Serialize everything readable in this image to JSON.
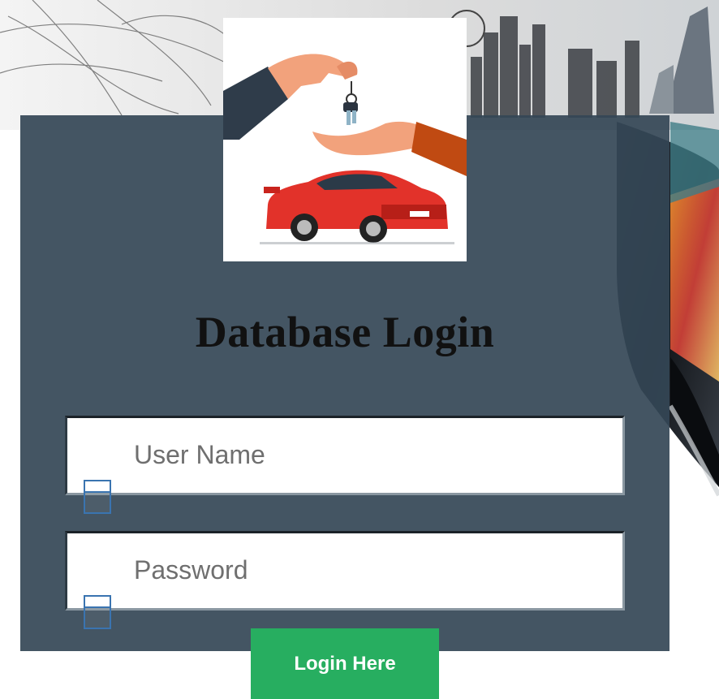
{
  "login": {
    "title": "Database Login",
    "username": {
      "placeholder": "User Name",
      "value": ""
    },
    "password": {
      "placeholder": "Password",
      "value": ""
    },
    "submit_label": "Login Here"
  },
  "icons": {
    "logo": "car-keys-handover-icon",
    "username_field": "user-icon",
    "password_field": "lock-icon"
  },
  "colors": {
    "panel": "#344656",
    "button": "#27ae60",
    "title": "#111111"
  }
}
